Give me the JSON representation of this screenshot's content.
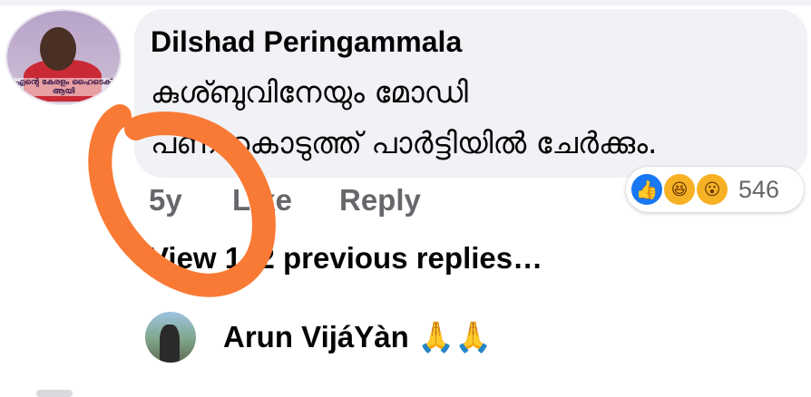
{
  "comment": {
    "author": "Dilshad Peringammala",
    "avatar_caption": "എന്റെ കേരളം ഹൈടെക് ആയി",
    "text_lines": [
      "കുശ്ബുവിനേയും മോഡി",
      "പണംകൊടുത്ത് പാർട്ടിയിൽ ചേർക്കും."
    ],
    "time": "5y",
    "like_label": "Like",
    "reply_label": "Reply",
    "reactions": {
      "icons": [
        "like-icon",
        "haha-icon",
        "wow-icon"
      ],
      "count": "546"
    }
  },
  "view_replies": "View 142 previous replies…",
  "reply": {
    "author": "Arun VijáYàn",
    "emoji": "🙏🙏"
  },
  "colors": {
    "bubble_bg": "#f0f2f5",
    "secondary_text": "#65676b",
    "like_blue": "#1877f2",
    "reaction_yellow": "#f7b125",
    "scribble_orange": "#f97a35"
  }
}
